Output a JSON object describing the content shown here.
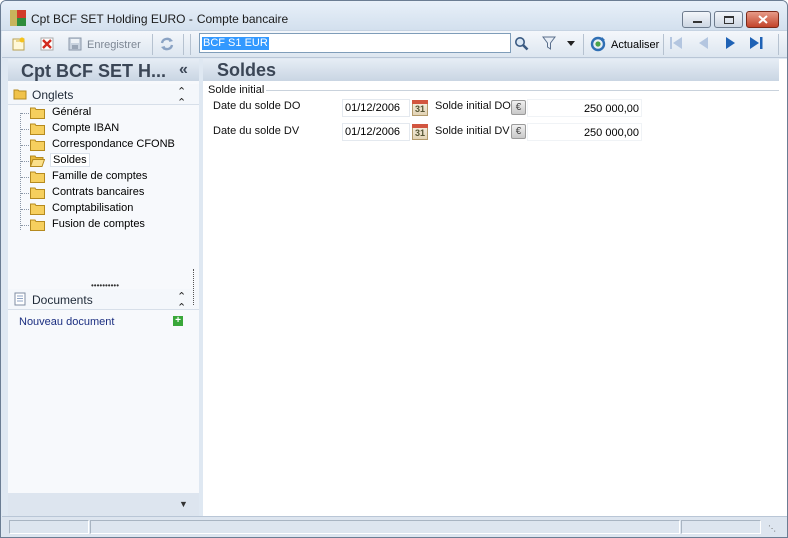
{
  "window": {
    "title_main": "Cpt BCF SET Holding EURO -",
    "title_sub": "Compte bancaire"
  },
  "toolbar": {
    "save_label": "Enregistrer",
    "search_value": "BCF S1 EUR",
    "refresh_label": "Actualiser"
  },
  "left": {
    "title": "Cpt BCF SET H...",
    "collapse": "«",
    "tabs_header": "Onglets",
    "tabs": [
      {
        "label": "Général"
      },
      {
        "label": "Compte IBAN"
      },
      {
        "label": "Correspondance CFONB"
      },
      {
        "label": "Soldes"
      },
      {
        "label": "Famille de comptes"
      },
      {
        "label": "Contrats bancaires"
      },
      {
        "label": "Comptabilisation"
      },
      {
        "label": "Fusion de comptes"
      }
    ],
    "selected_tab": "Soldes",
    "splitter": "••••••••••",
    "documents_header": "Documents",
    "new_document": "Nouveau document"
  },
  "main": {
    "title": "Soldes",
    "group": "Solde initial",
    "rows": [
      {
        "date_label": "Date du solde DO",
        "date_value": "01/12/2006",
        "amount_label": "Solde initial DO",
        "amount_value": "250 000,00"
      },
      {
        "date_label": "Date du solde DV",
        "date_value": "01/12/2006",
        "amount_label": "Solde initial DV",
        "amount_value": "250 000,00"
      }
    ],
    "calendar_day": "31",
    "currency_symbol": "€"
  },
  "colors": {
    "accent": "#3399ff",
    "header": "#3b4656",
    "link": "#1b2e80"
  },
  "icons": {
    "app": "app-icon",
    "new": "new-record-icon",
    "delete": "delete-icon",
    "save": "save-icon",
    "sync": "sync-icon",
    "search": "search-icon",
    "filter": "filter-icon",
    "refresh": "refresh-icon",
    "first": "first-record-icon",
    "prev": "previous-record-icon",
    "next": "next-record-icon",
    "last": "last-record-icon"
  }
}
